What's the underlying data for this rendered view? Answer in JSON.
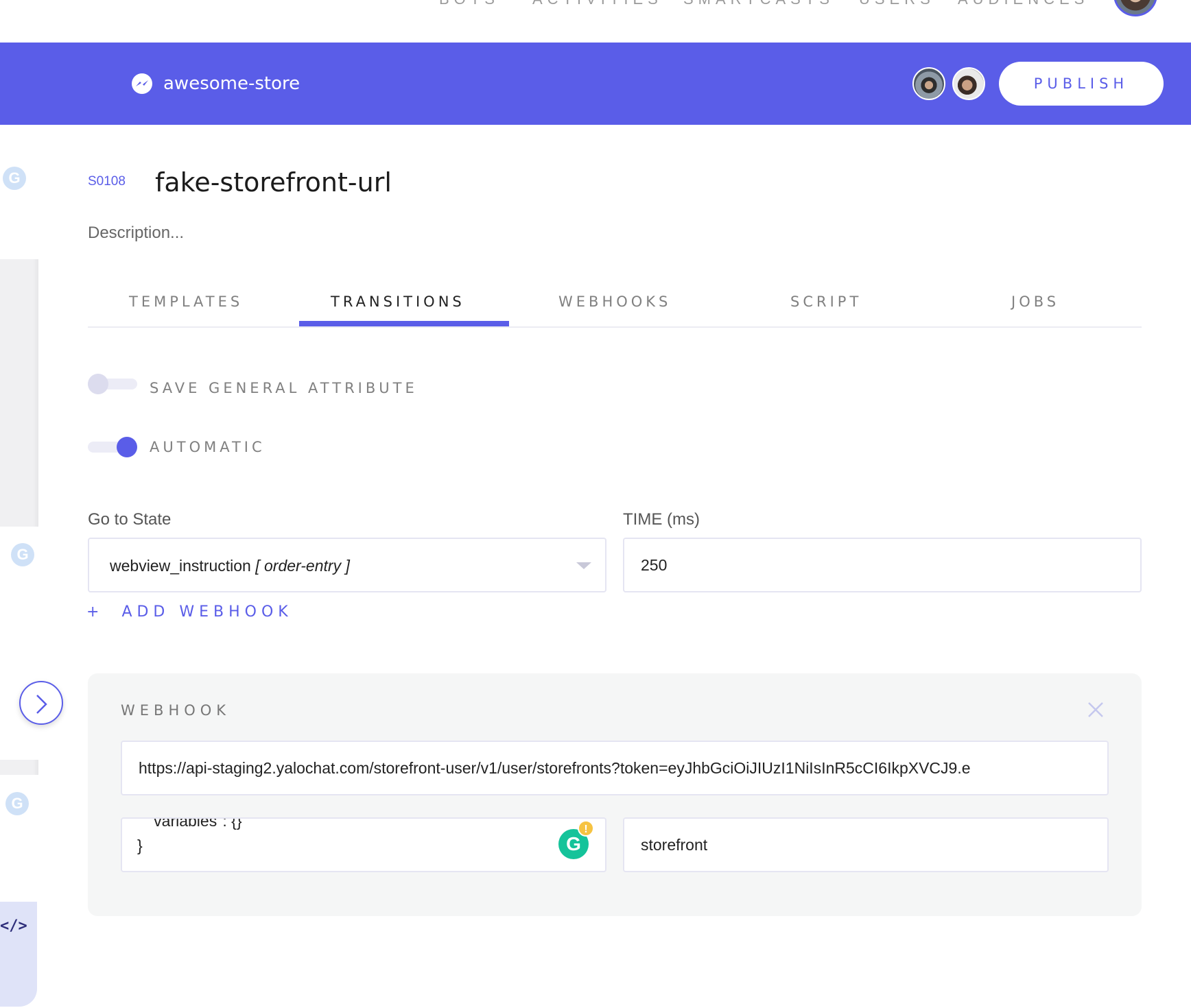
{
  "top_nav": {
    "items": [
      "BOTS",
      "ACTIVITIES",
      "SMARTCASTS",
      "USERS",
      "AUDIENCES"
    ]
  },
  "header": {
    "app_name": "awesome-store",
    "publish_label": "PUBLISH",
    "accent_color": "#5a5de8"
  },
  "left_rail": {
    "g_labels": [
      "G",
      "G",
      "G"
    ],
    "code_label": "</>"
  },
  "state": {
    "id": "S0108",
    "name": "fake-storefront-url",
    "description_placeholder": "Description..."
  },
  "tabs": [
    {
      "label": "TEMPLATES",
      "active": false
    },
    {
      "label": "TRANSITIONS",
      "active": true
    },
    {
      "label": "WEBHOOKS",
      "active": false
    },
    {
      "label": "SCRIPT",
      "active": false
    },
    {
      "label": "JOBS",
      "active": false
    }
  ],
  "toggles": {
    "save_general_attribute": {
      "label": "SAVE GENERAL ATTRIBUTE",
      "on": false
    },
    "automatic": {
      "label": "AUTOMATIC",
      "on": true
    }
  },
  "go_to_state": {
    "label": "Go to State",
    "value_name": "webview_instruction",
    "value_tag": "[ order-entry ]"
  },
  "time": {
    "label": "TIME (ms)",
    "value": "250"
  },
  "add_webhook_label": "ADD WEBHOOK",
  "webhook": {
    "title": "WEBHOOK",
    "url": "https://api-staging2.yalochat.com/storefront-user/v1/user/storefronts?token=eyJhbGciOiJIUzI1NiIsInR5cCI6IkpXVCJ9.e",
    "body_line1": "\"variables\": {}",
    "body_line2": "}",
    "name_value": "storefront"
  }
}
